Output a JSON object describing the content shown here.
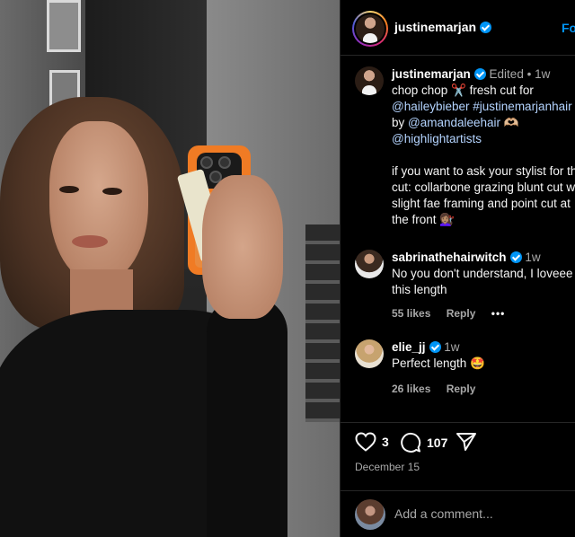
{
  "header": {
    "username": "justinemarjan",
    "follow_label": "Fo"
  },
  "caption": {
    "username": "justinemarjan",
    "edited": "Edited",
    "separator": "•",
    "time": "1w",
    "line1": "chop chop ✂️ fresh cut for",
    "mention1": "@haileybieber",
    "hashtag1": "#justinemarjanhair",
    "by_text": "by",
    "mention2": "@amandaleehair",
    "hands": "🫶🏼",
    "mention3": "@highlightartists",
    "para2_line1": "if you want to ask your stylist for this",
    "para2_line2": "cut: collarbone grazing blunt cut with",
    "para2_line3": "slight fae framing and point cut at",
    "para2_line4": "the front 💇🏽‍♀️"
  },
  "comments": [
    {
      "username": "sabrinathehairwitch",
      "time": "1w",
      "text_line1": "No you don't understand, I loveee",
      "text_line2": "this length",
      "likes": "55 likes",
      "reply": "Reply",
      "more": "•••"
    },
    {
      "username": "elie_jj",
      "time": "1w",
      "text_line1": "Perfect length 🤩",
      "likes": "26 likes",
      "reply": "Reply"
    }
  ],
  "actions": {
    "like_count": "3",
    "comment_count": "107",
    "date": "December 15"
  },
  "comment_box": {
    "placeholder": "Add a comment..."
  },
  "colors": {
    "background": "#000000",
    "link": "#e0f1ff",
    "verified": "#0095f6",
    "muted": "#a8a8a8"
  }
}
